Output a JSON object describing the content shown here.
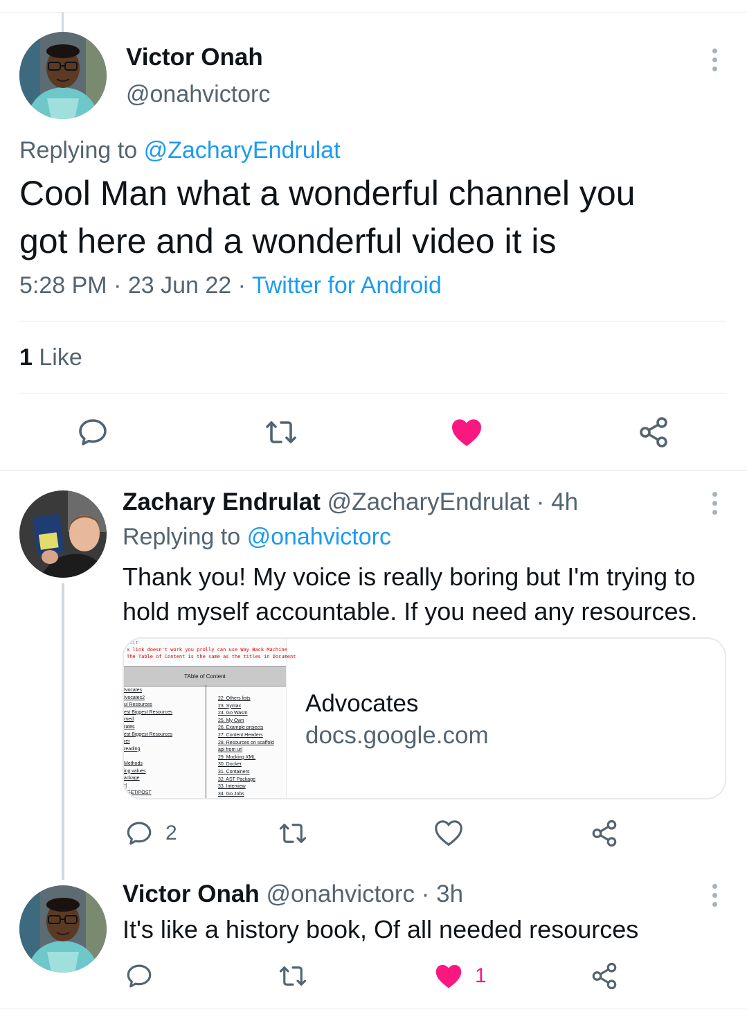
{
  "main_tweet": {
    "name": "Victor Onah",
    "handle": "@onahvictorc",
    "replying_prefix": "Replying to",
    "replying_to": "@ZacharyEndrulat",
    "text_line1": "Cool Man what a wonderful channel you",
    "text_line2": "got here and a wonderful video it is",
    "time": "5:28 PM",
    "sep1": "·",
    "date": "23 Jun 22",
    "sep2": "·",
    "source": "Twitter for Android",
    "likes_count": "1",
    "likes_label": "Like",
    "liked": true
  },
  "reply1": {
    "name": "Zachary Endrulat",
    "handle": "@ZacharyEndrulat",
    "sep": "·",
    "age": "4h",
    "replying_prefix": "Replying to",
    "replying_to": "@onahvictorc",
    "text_line1": "Thank you! My voice is really boring but I'm trying to",
    "text_line2": "hold myself accountable.  If you need any resources.",
    "card": {
      "title": "Advocates",
      "domain": "docs.google.com",
      "thumb": {
        "red_line0": "l=it",
        "red_line1": "x link doesn't work you prolly can use Way Back Machine",
        "red_line2": "The Table of Content is the same as the titles in Document",
        "toc_title": "TAble of Content",
        "left_items": [
          "Ivocates",
          "Ivocates2",
          "ul Resources",
          "est Biggest Resources",
          "rned",
          "rates",
          "est Biggest Resources",
          "rer",
          "reading",
          "",
          "Methods",
          "ing values",
          "ackage",
          "rl",
          "   ·/GET/POST"
        ],
        "right_items": [
          "22. Others lists",
          "23. Syntax",
          "24. Go Wasm",
          "25. My Own",
          "26. Example projects",
          "27. Content Headers",
          "28. Resources on scaffold",
          "    api from url",
          "29. Mocking XML",
          "30. Docker",
          "31. Containers",
          "32. AST Package",
          "33. Interview",
          "34. Go Jobs"
        ]
      }
    },
    "reply_count": "2",
    "like_count": ""
  },
  "reply2": {
    "name": "Victor Onah",
    "handle": "@onahvictorc",
    "sep": "·",
    "age": "3h",
    "text": "It's like a history book, Of all needed resources",
    "like_count": "1",
    "liked": true
  },
  "colors": {
    "accent": "#1d9bf0",
    "like": "#f91880",
    "muted": "#536471",
    "icon": "#536471"
  }
}
